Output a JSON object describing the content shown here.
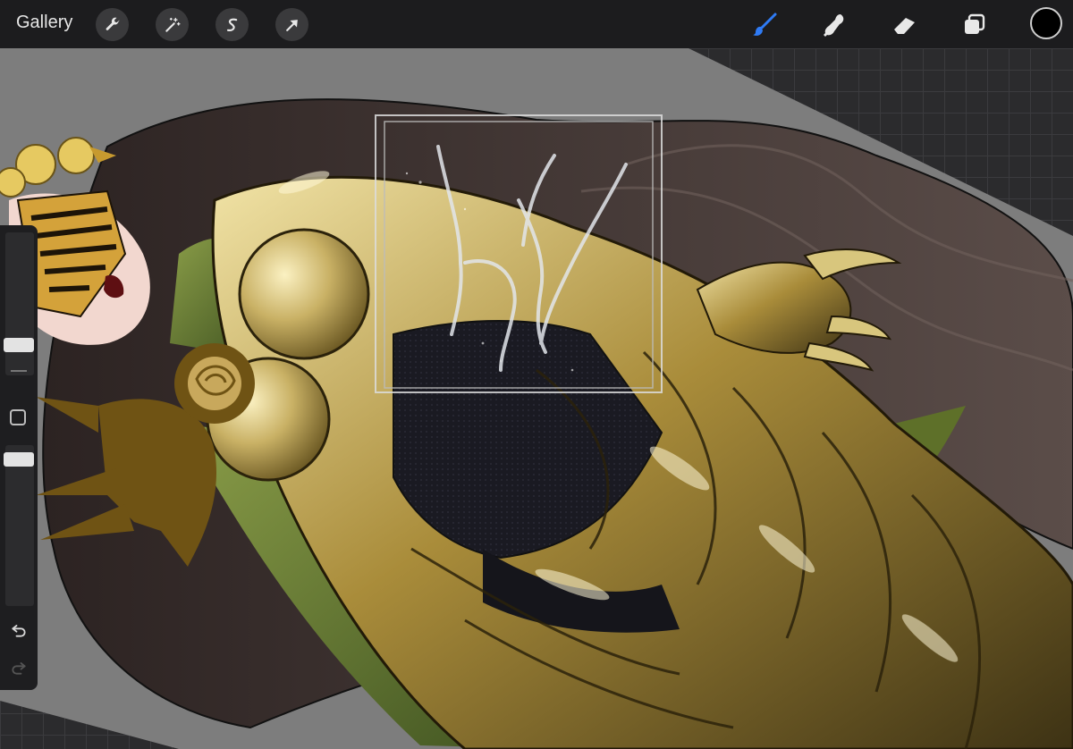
{
  "toolbar": {
    "gallery_label": "Gallery",
    "left_tools": [
      {
        "name": "actions",
        "icon": "wrench-icon"
      },
      {
        "name": "adjustments",
        "icon": "magic-wand-icon"
      },
      {
        "name": "selection",
        "icon": "selection-s-icon"
      },
      {
        "name": "transform",
        "icon": "arrow-cursor-icon"
      }
    ],
    "right_tools": [
      {
        "name": "brush",
        "icon": "brush-icon",
        "active": true
      },
      {
        "name": "smudge",
        "icon": "smudge-icon",
        "active": false
      },
      {
        "name": "eraser",
        "icon": "eraser-icon",
        "active": false
      },
      {
        "name": "layers",
        "icon": "layers-icon",
        "active": false
      }
    ],
    "current_color": "#000000",
    "active_tool_color": "#2f7bf5"
  },
  "sidebar": {
    "brush_size_level": 0.18,
    "opacity_level": 0.95,
    "modify_button": "square-icon",
    "undo": "undo-icon",
    "redo": "redo-icon"
  },
  "canvas": {
    "artwork": "golden-armored-figure-illustration",
    "palette": {
      "gold": "#b59a4a",
      "dark_gold": "#5a4a1f",
      "hair": "#3f3431",
      "green": "#556b2f",
      "bg_gray": "#7b7b7b",
      "lightning": "#d9dde0"
    }
  }
}
